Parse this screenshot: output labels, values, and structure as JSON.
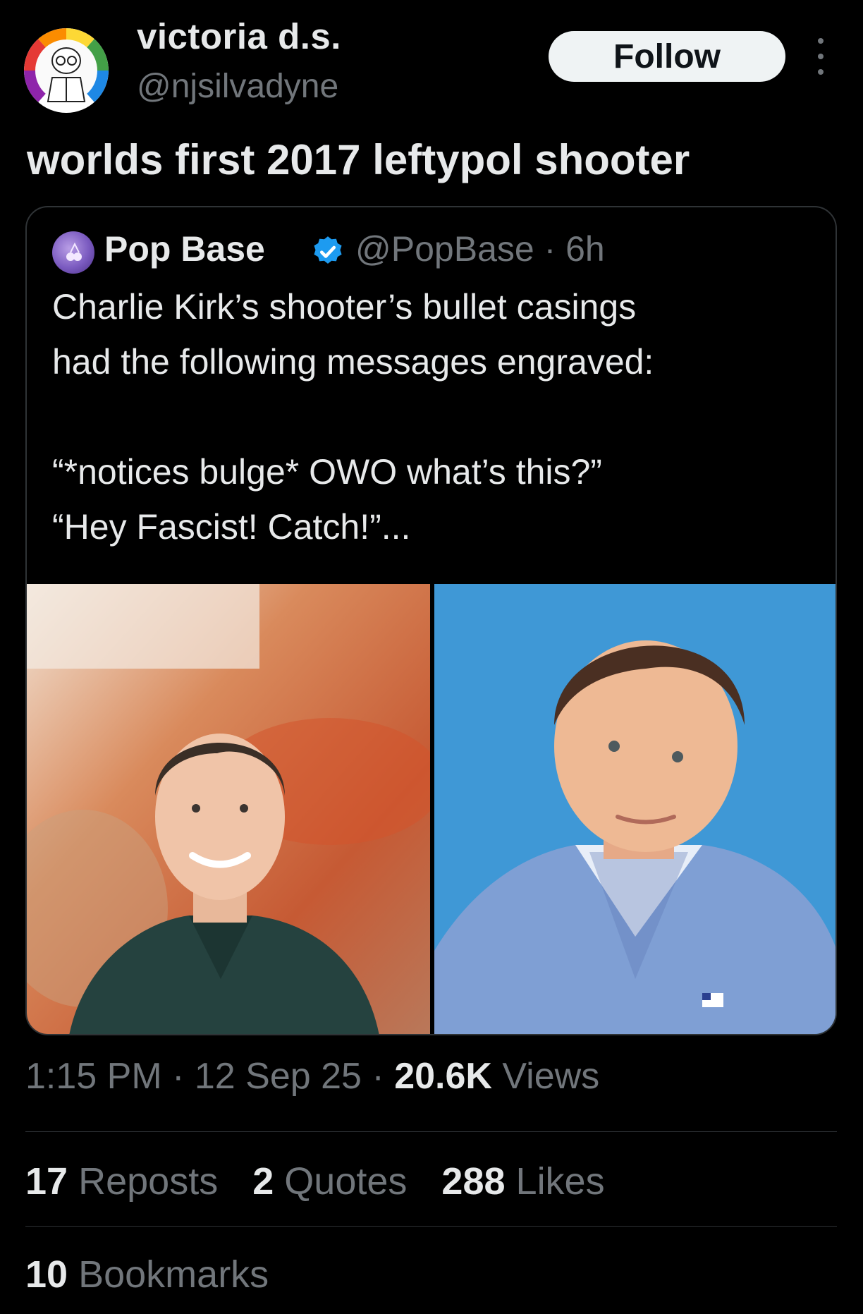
{
  "author": {
    "display_name": "victoria d.s.",
    "handle": "@njsilvadyne"
  },
  "follow_label": "Follow",
  "tweet_text": "worlds first 2017 leftypol shooter",
  "quoted": {
    "name": "Pop Base",
    "handle_time": "@PopBase · 6h",
    "lines": [
      "Charlie Kirk’s shooter’s bullet casings",
      "had the following messages engraved:",
      "",
      "“*notices bulge* OWO what’s this?”",
      "“Hey Fascist! Catch!”..."
    ]
  },
  "meta": {
    "time": "1:15 PM",
    "date": "12 Sep 25",
    "views_count": "20.6K",
    "views_label": "Views"
  },
  "stats": {
    "reposts_count": "17",
    "reposts_label": "Reposts",
    "quotes_count": "2",
    "quotes_label": "Quotes",
    "likes_count": "288",
    "likes_label": "Likes",
    "bookmarks_count": "10",
    "bookmarks_label": "Bookmarks"
  },
  "colors": {
    "background": "#000000",
    "text_primary": "#e7e9ea",
    "text_secondary": "#71767b",
    "verified_blue": "#1d9bf0",
    "border": "#2f3336"
  },
  "icons": [
    "avatar-illustration",
    "more-icon",
    "pop-base-avatar",
    "verified-badge-icon"
  ]
}
